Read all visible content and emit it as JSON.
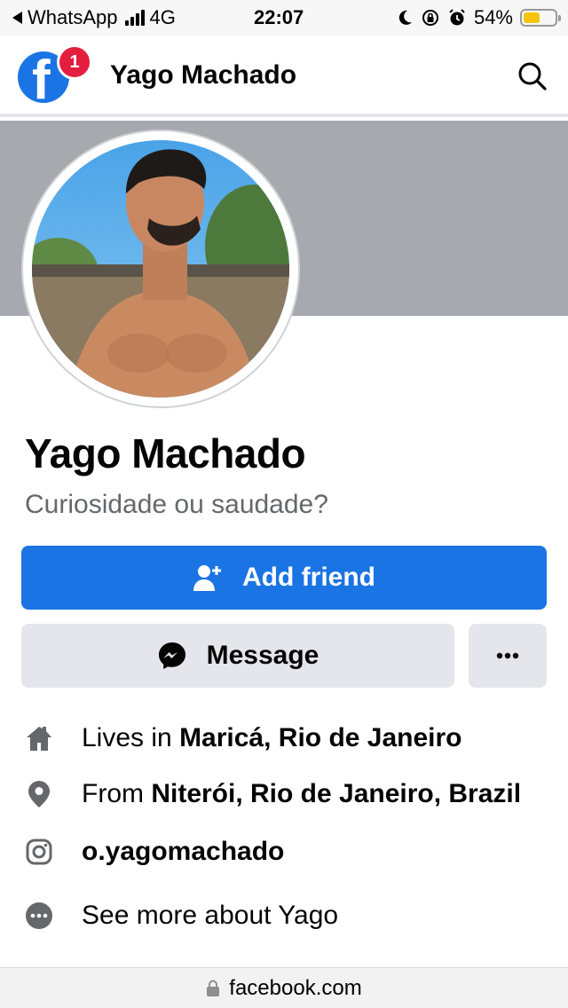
{
  "status_bar": {
    "back_app": "WhatsApp",
    "network": "4G",
    "time": "22:07",
    "battery_percent": "54%",
    "battery_level": 0.54
  },
  "header": {
    "notification_count": "1",
    "title": "Yago Machado",
    "icons": [
      "facebook-logo-icon",
      "search-icon"
    ]
  },
  "profile": {
    "name": "Yago Machado",
    "bio": "Curiosidade ou saudade?"
  },
  "actions": {
    "add_friend": "Add friend",
    "message": "Message",
    "more": "•••"
  },
  "details": [
    {
      "icon": "home-icon",
      "prefix": "Lives in ",
      "value": "Maricá, Rio de Janeiro"
    },
    {
      "icon": "location-pin-icon",
      "prefix": "From ",
      "value": "Niterói, Rio de Janeiro, Brazil"
    },
    {
      "icon": "instagram-icon",
      "prefix": "",
      "value": "o.yagomachado"
    },
    {
      "icon": "more-dots-icon",
      "prefix": "See more about Yago",
      "value": ""
    }
  ],
  "browser": {
    "url": "facebook.com"
  },
  "colors": {
    "primary": "#1b74e4",
    "badge": "#e41e3f",
    "secondary_button": "#e4e6eb",
    "cover": "#a6a9ad",
    "muted_text": "#65676b",
    "battery": "#f6c40f"
  }
}
